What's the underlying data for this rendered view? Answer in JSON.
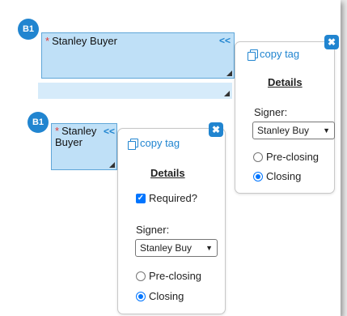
{
  "field1": {
    "badge": "B1",
    "required_mark": "*",
    "label": "Stanley Buyer",
    "collapse": "<<"
  },
  "field2": {
    "badge": "B1",
    "required_mark": "*",
    "label_line1": "Stanley",
    "label_line2": "Buyer",
    "collapse": "<<"
  },
  "panel1": {
    "close": "✖",
    "copy_tag": "copy tag",
    "details": "Details",
    "signer_label": "Signer:",
    "signer_value": "Stanley Buy",
    "radio_pre": "Pre-closing",
    "radio_closing": "Closing"
  },
  "panel2": {
    "close": "✖",
    "copy_tag": "copy tag",
    "details": "Details",
    "required_label": "Required?",
    "signer_label": "Signer:",
    "signer_value": "Stanley Buy",
    "radio_pre": "Pre-closing",
    "radio_closing": "Closing"
  },
  "colors": {
    "accent": "#2185d0",
    "field_fill": "#bfe0f7",
    "required": "#e53935"
  }
}
